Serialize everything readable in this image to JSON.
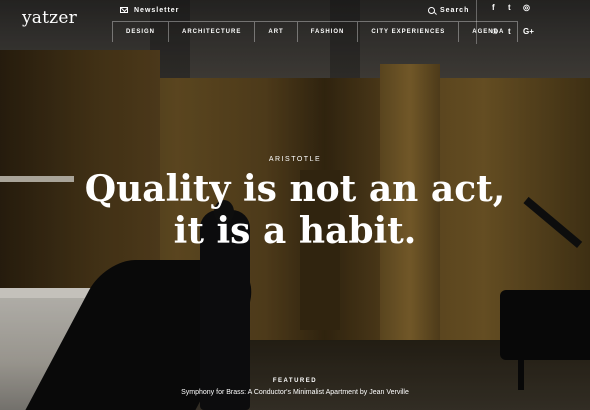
{
  "brand": {
    "logo": "yatzer"
  },
  "header": {
    "newsletter_label": "Newsletter",
    "search_label": "Search",
    "nav": [
      "DESIGN",
      "ARCHITECTURE",
      "ART",
      "FASHION",
      "CITY EXPERIENCES",
      "AGENDA"
    ],
    "social_top": [
      {
        "icon": "facebook-icon",
        "glyph": "f"
      },
      {
        "icon": "twitter-icon",
        "glyph": "t"
      },
      {
        "icon": "instagram-icon",
        "glyph": "◎"
      }
    ],
    "social_bottom": [
      {
        "icon": "pinterest-icon",
        "glyph": "℗"
      },
      {
        "icon": "tumblr-icon",
        "glyph": "t"
      },
      {
        "icon": "google-plus-icon",
        "glyph": "G+"
      }
    ]
  },
  "hero": {
    "kicker": "ARISTOTLE",
    "quote": "Quality is not an act, it is a habit."
  },
  "featured": {
    "label": "FEATURED",
    "title": "Symphony for Brass: A Conductor's Minimalist Apartment by Jean Verville"
  }
}
